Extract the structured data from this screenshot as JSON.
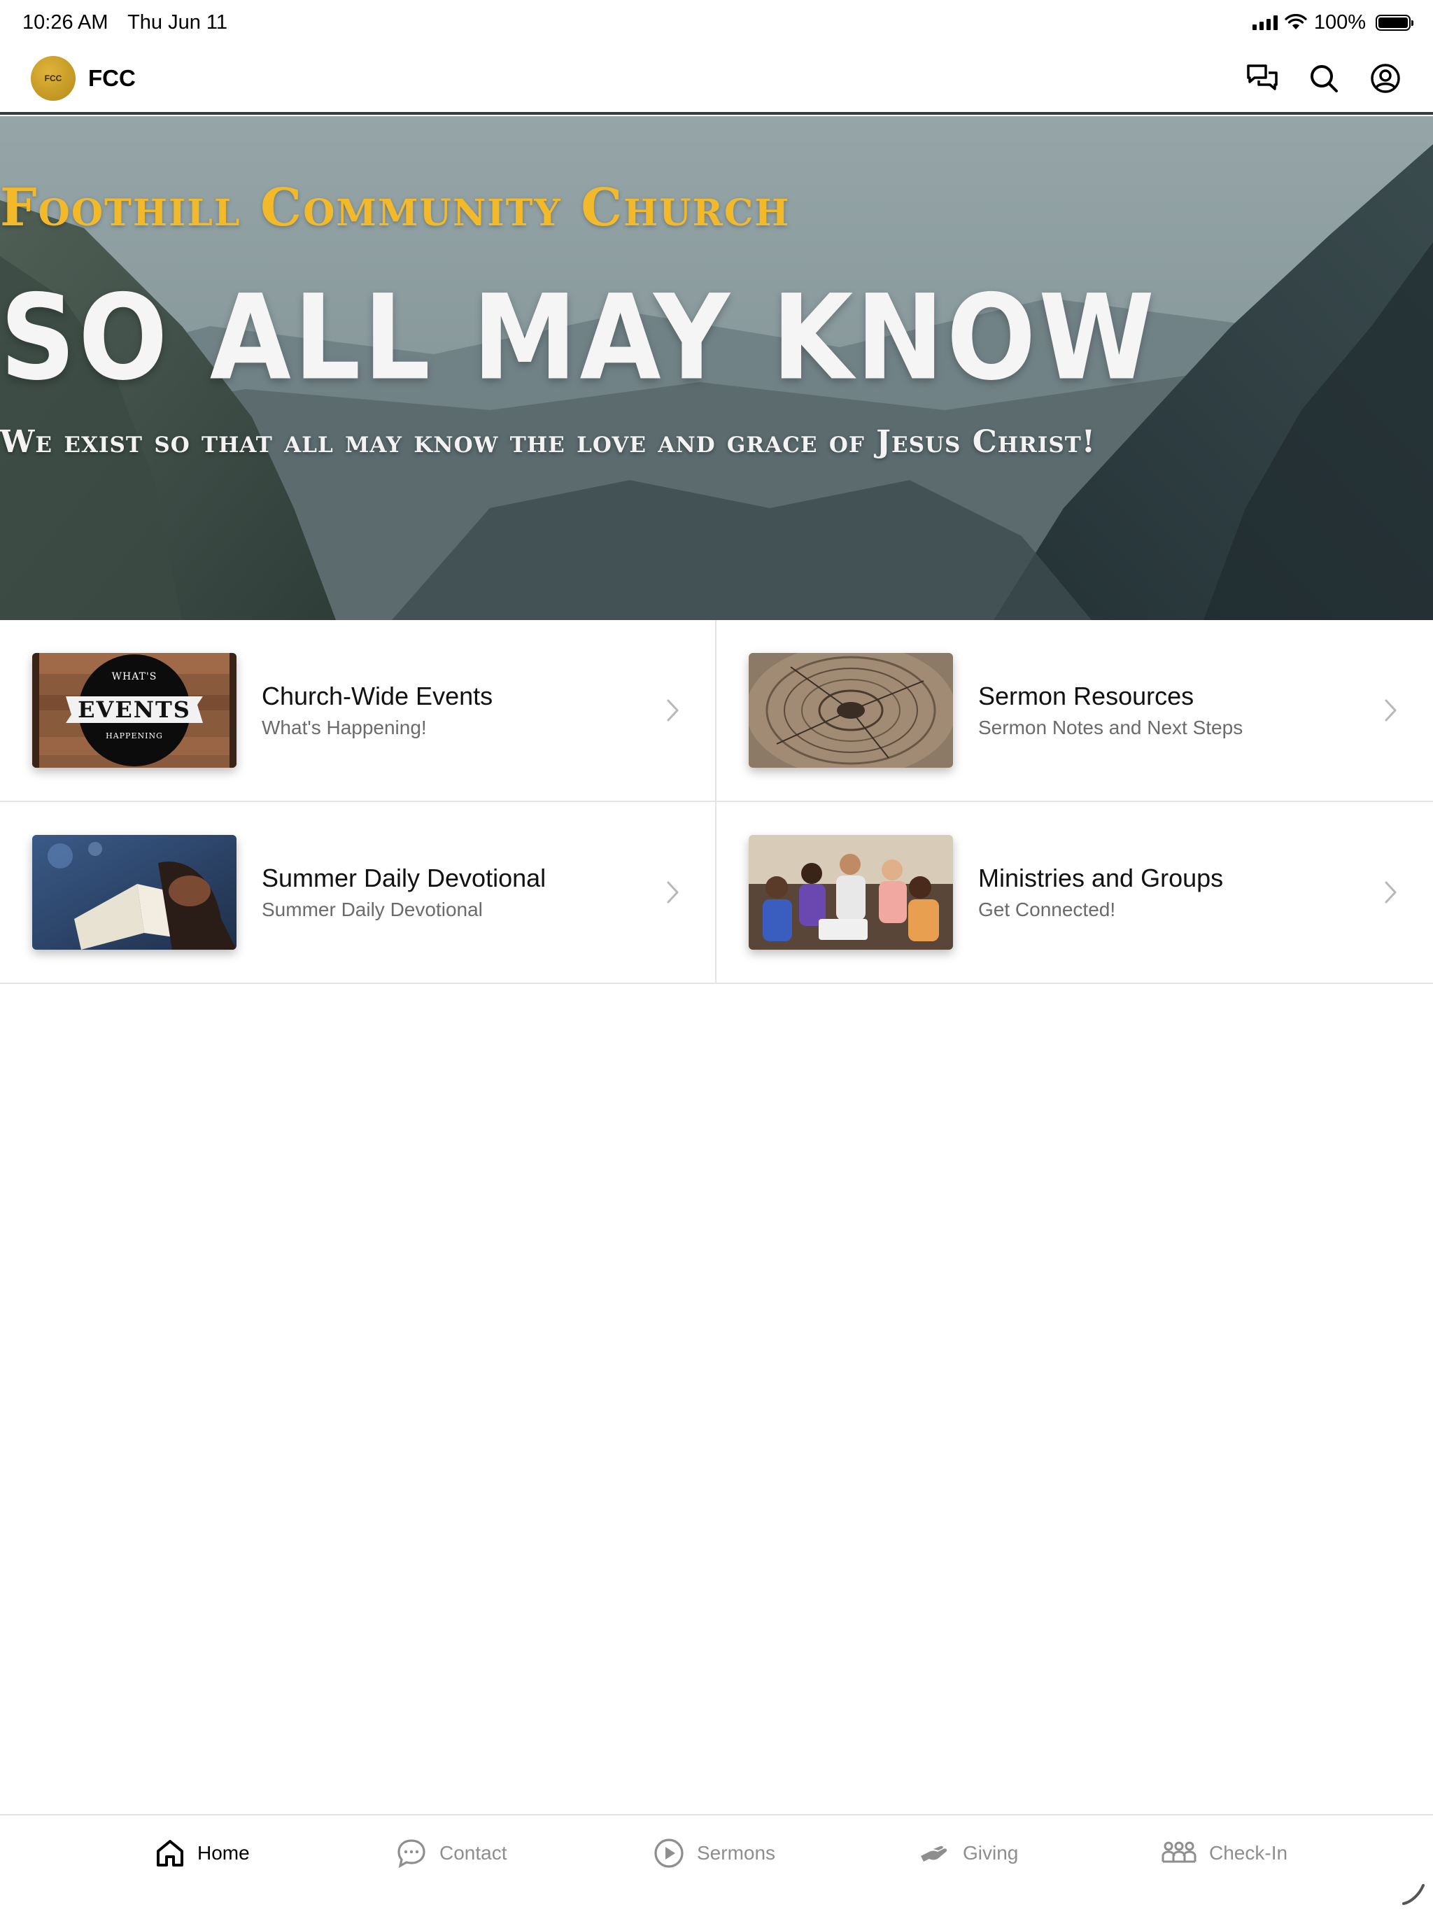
{
  "status_bar": {
    "time": "10:26 AM",
    "date": "Thu Jun 11",
    "battery": "100%"
  },
  "header": {
    "logo_text": "FCC",
    "app_name": "FCC",
    "icons": [
      "messages-icon",
      "search-icon",
      "account-icon"
    ]
  },
  "hero": {
    "kicker": "Foothill Community Church",
    "headline": "SO ALL MAY KNOW",
    "tagline": "We exist so that all may know the love and grace of Jesus Christ!"
  },
  "tiles": [
    {
      "title": "Church-Wide Events",
      "subtitle": "What's Happening!",
      "thumb": {
        "top": "WHAT'S",
        "main": "EVENTS",
        "bottom": "HAPPENING"
      }
    },
    {
      "title": "Sermon Resources",
      "subtitle": "Sermon Notes and Next Steps"
    },
    {
      "title": "Summer Daily Devotional",
      "subtitle": "Summer Daily Devotional"
    },
    {
      "title": "Ministries and Groups",
      "subtitle": "Get Connected!"
    }
  ],
  "tab_bar": {
    "items": [
      {
        "label": "Home",
        "icon": "home-icon",
        "active": true
      },
      {
        "label": "Contact",
        "icon": "chat-bubble-icon",
        "active": false
      },
      {
        "label": "Sermons",
        "icon": "play-circle-icon",
        "active": false
      },
      {
        "label": "Giving",
        "icon": "giving-hand-icon",
        "active": false
      },
      {
        "label": "Check-In",
        "icon": "people-group-icon",
        "active": false
      }
    ]
  },
  "colors": {
    "accent_gold": "#f2b92a",
    "header_rule": "#333b3f",
    "active_tab": "#000000",
    "inactive_tab": "#8e8e8e"
  }
}
